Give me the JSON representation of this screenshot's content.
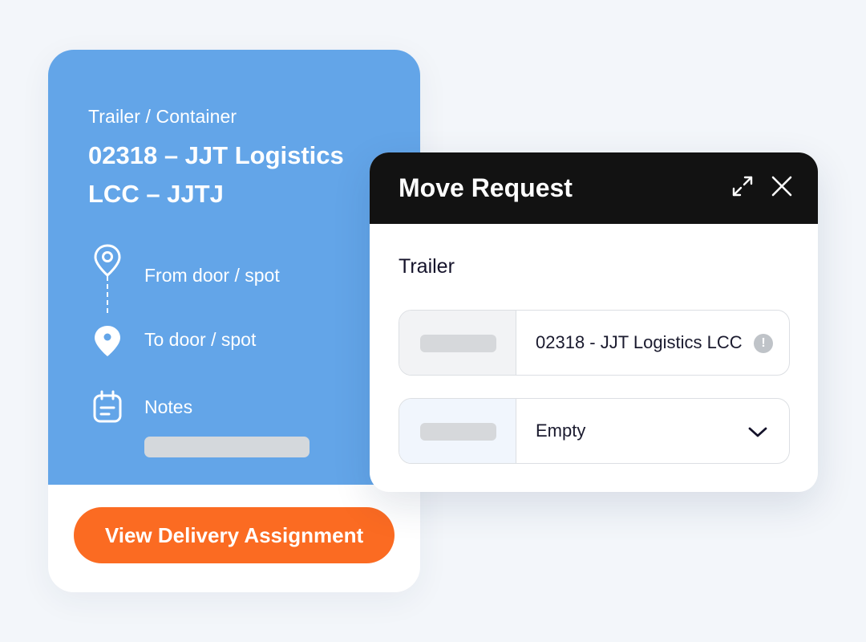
{
  "trailer_card": {
    "eyebrow": "Trailer / Container",
    "title": "02318 – JJT Logistics LCC – JJTJ",
    "route": {
      "from_label": "From door / spot",
      "to_label": "To door / spot"
    },
    "notes_label": "Notes",
    "cta_label": "View Delivery Assignment",
    "colors": {
      "card_blue": "#63a5e8",
      "cta_orange": "#fb6b22"
    }
  },
  "modal": {
    "title": "Move Request",
    "expand_icon": "expand-icon",
    "close_icon": "close-icon",
    "section_label": "Trailer",
    "trailer_field": {
      "value": "02318 - JJT Logistics LCC",
      "badge_icon": "info-icon",
      "badge_glyph": "!"
    },
    "status_field": {
      "value": "Empty",
      "dropdown_icon": "chevron-down-icon"
    },
    "colors": {
      "header_bg": "#121212"
    }
  }
}
